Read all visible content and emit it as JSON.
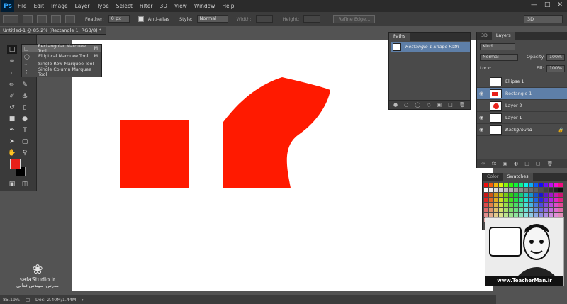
{
  "app": {
    "logo": "Ps"
  },
  "menu": [
    "File",
    "Edit",
    "Image",
    "Layer",
    "Type",
    "Select",
    "Filter",
    "3D",
    "View",
    "Window",
    "Help"
  ],
  "options_bar": {
    "feather_label": "Feather:",
    "feather_value": "0 px",
    "antialias_label": "Anti-alias",
    "style_label": "Style:",
    "style_value": "Normal",
    "width_label": "Width:",
    "height_label": "Height:",
    "refine_edge": "Refine Edge...",
    "workspace": "3D"
  },
  "document": {
    "tab_title": "Untitled-1 @ 85.2% (Rectangle 1, RGB/8) *"
  },
  "tool_flyout": {
    "items": [
      {
        "label": "Rectangular Marquee Tool",
        "shortcut": "M"
      },
      {
        "label": "Elliptical Marquee Tool",
        "shortcut": "M"
      },
      {
        "label": "Single Row Marquee Tool",
        "shortcut": ""
      },
      {
        "label": "Single Column Marquee Tool",
        "shortcut": ""
      }
    ]
  },
  "paths_panel": {
    "tab": "Paths",
    "items": [
      {
        "label": "Rectangle 1 Shape Path"
      }
    ]
  },
  "layers_panel": {
    "tabs": [
      "3D",
      "Layers"
    ],
    "kind": "Kind",
    "blend_mode": "Normal",
    "opacity_label": "Opacity:",
    "opacity_value": "100%",
    "lock_label": "Lock:",
    "fill_label": "Fill:",
    "fill_value": "100%",
    "layers": [
      {
        "name": "Ellipse 1",
        "selected": false,
        "visible": false
      },
      {
        "name": "Rectangle 1",
        "selected": true,
        "visible": true
      },
      {
        "name": "Layer 2",
        "selected": false,
        "visible": false
      },
      {
        "name": "Layer 1",
        "selected": false,
        "visible": true
      },
      {
        "name": "Background",
        "selected": false,
        "visible": true
      }
    ]
  },
  "swatches_panel": {
    "tabs": [
      "Color",
      "Swatches"
    ]
  },
  "colors": {
    "foreground": "#e8201a",
    "background": "#000000",
    "shape": "#ff1a00",
    "selection": "#5e7fa8"
  },
  "watermark": {
    "brand": "safaStudio.ir",
    "credit": "مدرس: مهندس فدائی"
  },
  "teacher": {
    "url": "www.TeacherMan.ir"
  },
  "status_bar": {
    "zoom": "85.19%",
    "doc": "Doc: 2.40M/1.44M"
  }
}
